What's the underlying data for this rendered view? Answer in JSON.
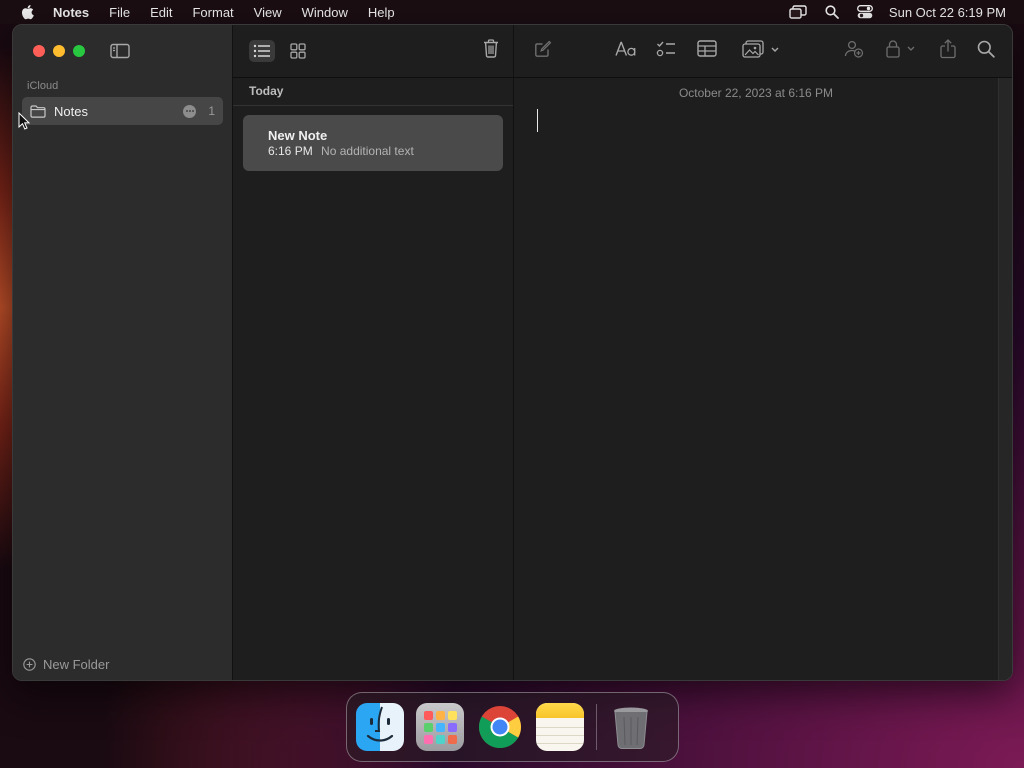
{
  "menubar": {
    "app_name": "Notes",
    "menus": [
      "File",
      "Edit",
      "Format",
      "View",
      "Window",
      "Help"
    ],
    "clock": "Sun Oct 22  6:19 PM",
    "status_icons": [
      "screen-mirroring-icon",
      "spotlight-search-icon",
      "control-center-icon"
    ]
  },
  "sidebar": {
    "section_label": "iCloud",
    "folders": [
      {
        "label": "Notes",
        "count": "1",
        "icon": "folder-icon"
      }
    ],
    "new_folder_label": "New Folder"
  },
  "note_list": {
    "group_header": "Today",
    "notes": [
      {
        "title": "New Note",
        "time": "6:16 PM",
        "preview": "No additional text"
      }
    ]
  },
  "editor": {
    "date": "October 22, 2023 at 6:16 PM",
    "toolbar_icons": [
      "compose-icon",
      "text-format-icon",
      "checklist-icon",
      "table-icon",
      "media-icon",
      "collaborate-icon",
      "lock-icon",
      "share-icon",
      "search-icon"
    ]
  },
  "dock": {
    "apps": [
      "Finder",
      "Launchpad",
      "Google Chrome",
      "Notes",
      "Trash"
    ]
  },
  "colors": {
    "close": "#ff5f57",
    "minimize": "#febc2e",
    "zoom": "#28c840",
    "selected_folder": "#464646",
    "selected_note": "#4a4a4a",
    "notes_accent": "#f8c52a"
  }
}
